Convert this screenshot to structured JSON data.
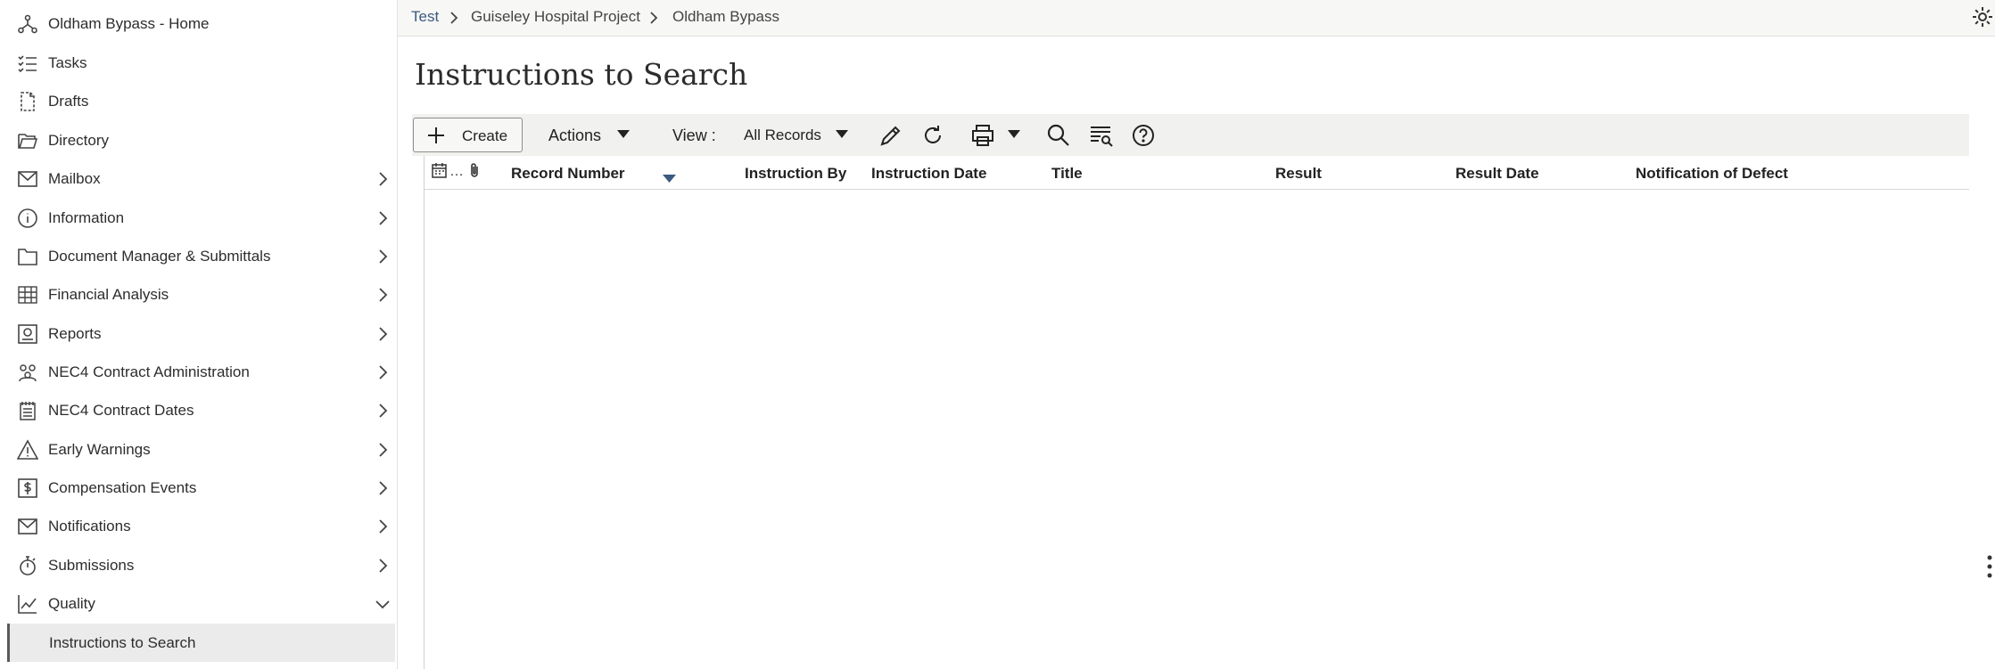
{
  "sidebar": {
    "items": [
      {
        "label": "Oldham Bypass - Home",
        "icon": "project-tree-icon",
        "has_chevron": false
      },
      {
        "label": "Tasks",
        "icon": "task-list-icon",
        "has_chevron": false
      },
      {
        "label": "Drafts",
        "icon": "drafts-icon",
        "has_chevron": false
      },
      {
        "label": "Directory",
        "icon": "folder-open-icon",
        "has_chevron": false
      },
      {
        "label": "Mailbox",
        "icon": "mail-icon",
        "has_chevron": true
      },
      {
        "label": "Information",
        "icon": "info-icon",
        "has_chevron": true
      },
      {
        "label": "Document Manager & Submittals",
        "icon": "folder-icon",
        "has_chevron": true
      },
      {
        "label": "Financial Analysis",
        "icon": "spreadsheet-icon",
        "has_chevron": true
      },
      {
        "label": "Reports",
        "icon": "report-icon",
        "has_chevron": true
      },
      {
        "label": "NEC4 Contract Administration",
        "icon": "people-network-icon",
        "has_chevron": true
      },
      {
        "label": "NEC4 Contract Dates",
        "icon": "calendar-pad-icon",
        "has_chevron": true
      },
      {
        "label": "Early Warnings",
        "icon": "warning-icon",
        "has_chevron": true
      },
      {
        "label": "Compensation Events",
        "icon": "dollar-icon",
        "has_chevron": true
      },
      {
        "label": "Notifications",
        "icon": "mail-icon",
        "has_chevron": true
      },
      {
        "label": "Submissions",
        "icon": "stopwatch-icon",
        "has_chevron": true
      },
      {
        "label": "Quality",
        "icon": "line-chart-icon",
        "has_chevron": true,
        "expanded": true
      }
    ],
    "sub_item": {
      "label": "Instructions to Search"
    }
  },
  "breadcrumb": {
    "items": [
      "Test",
      "Guiseley Hospital Project",
      "Oldham Bypass"
    ]
  },
  "page": {
    "title": "Instructions to Search"
  },
  "toolbar": {
    "create_label": "Create",
    "actions_label": "Actions",
    "view_label": "View :",
    "view_value": "All Records"
  },
  "table": {
    "columns": [
      "Record Number",
      "Instruction By",
      "Instruction Date",
      "Title",
      "Result",
      "Result Date",
      "Notification of Defect"
    ],
    "rows": []
  },
  "colors": {
    "accent": "#3b5a80",
    "toolbar_bg": "#f1f1ef",
    "selected_bg": "#ebebeb"
  }
}
